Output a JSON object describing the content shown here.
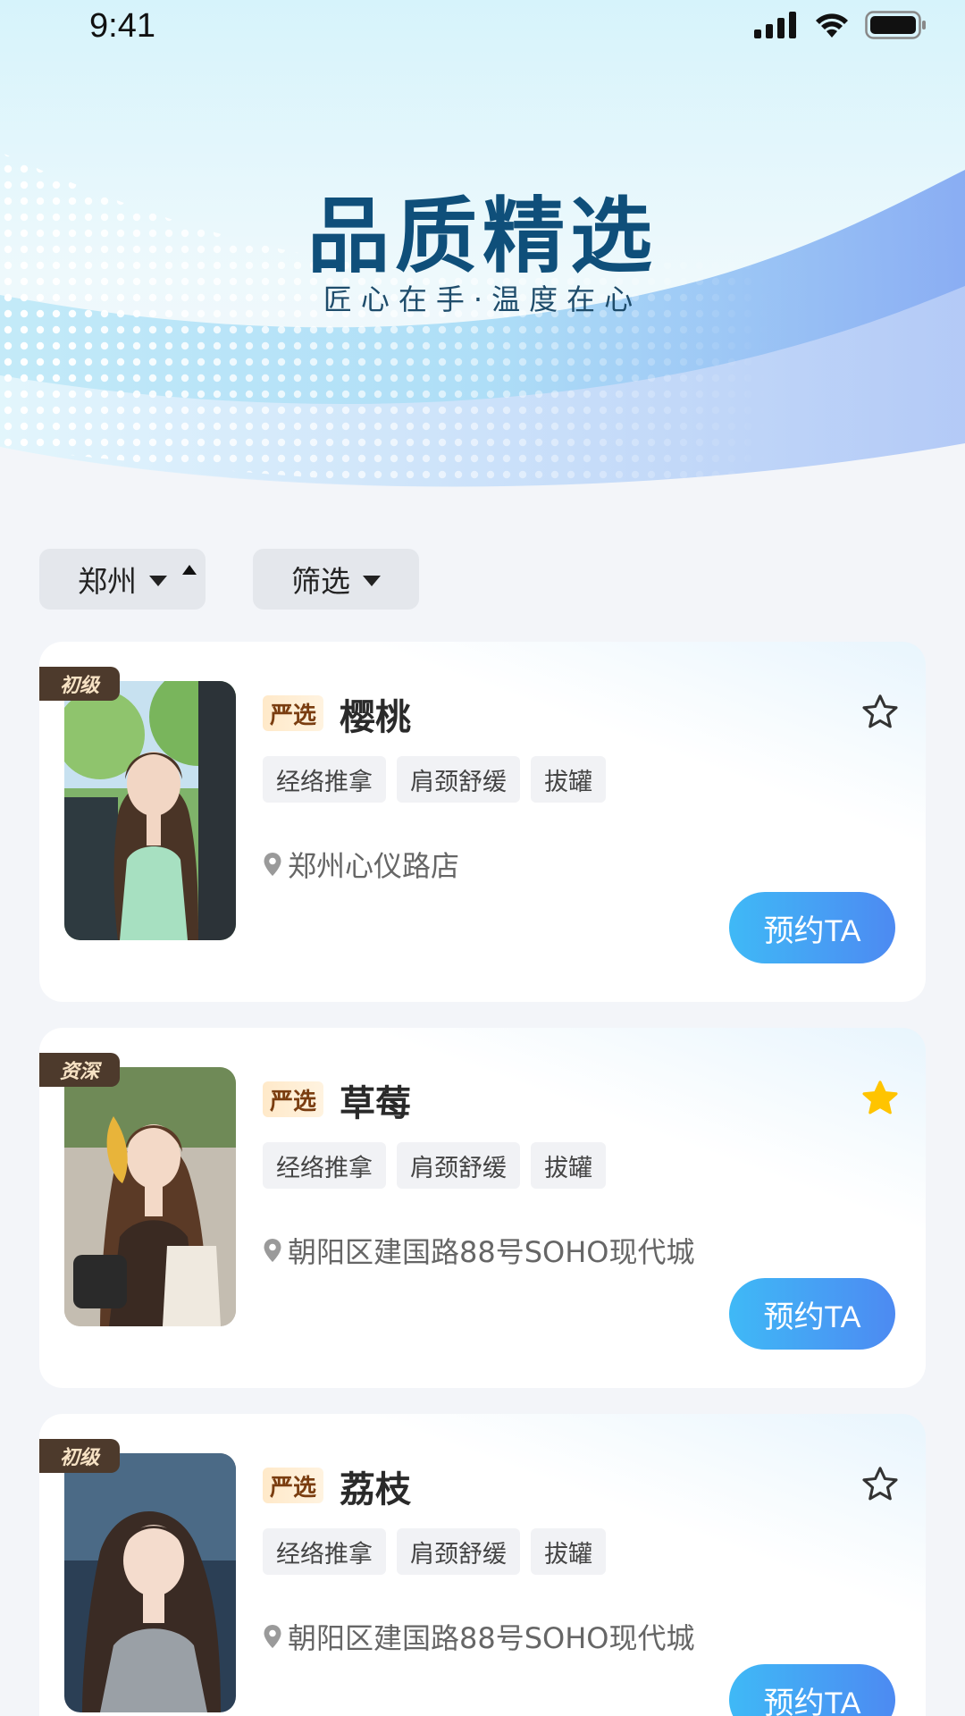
{
  "status_bar": {
    "time": "9:41"
  },
  "hero": {
    "title": "品质精选",
    "subtitle": "匠心在手·温度在心"
  },
  "filters": {
    "city": "郑州",
    "filter": "筛选"
  },
  "colors": {
    "accent_start": "#3fb9f6",
    "accent_end": "#4d8af2",
    "badge_brown": "#4d3a2c",
    "star_gold": "#ffc400"
  },
  "cards": [
    {
      "level": "初级",
      "select_label": "严选",
      "name": "樱桃",
      "favorited": false,
      "tags": [
        "经络推拿",
        "肩颈舒缓",
        "拔罐"
      ],
      "location": "郑州心仪路店",
      "book_label": "预约TA"
    },
    {
      "level": "资深",
      "select_label": "严选",
      "name": "草莓",
      "favorited": true,
      "tags": [
        "经络推拿",
        "肩颈舒缓",
        "拔罐"
      ],
      "location": "朝阳区建国路88号SOHO现代城",
      "book_label": "预约TA"
    },
    {
      "level": "初级",
      "select_label": "严选",
      "name": "荔枝",
      "favorited": false,
      "tags": [
        "经络推拿",
        "肩颈舒缓",
        "拔罐"
      ],
      "location": "朝阳区建国路88号SOHO现代城",
      "book_label": "预约TA"
    }
  ]
}
